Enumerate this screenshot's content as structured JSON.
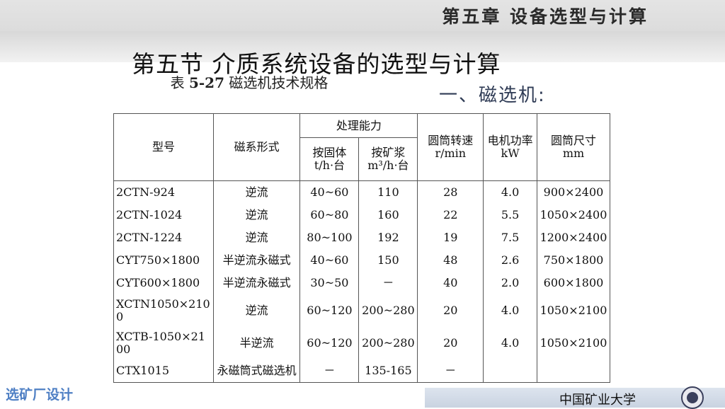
{
  "header": {
    "chapter": "第五章  设备选型与计算",
    "section": "第五节  介质系统设备的选型与计算"
  },
  "caption": {
    "label": "表",
    "number": "5-27",
    "rest": "磁选机技术规格"
  },
  "subheading": "一、磁选机:",
  "table": {
    "head": {
      "model": "型号",
      "type": "磁系形式",
      "capacity": "处理能力",
      "cap_solid": "按固体",
      "cap_solid_unit": "t/h·台",
      "cap_pulp": "按矿浆",
      "cap_pulp_unit": "m³/h·台",
      "speed": "圆筒转速",
      "speed_unit": "r/min",
      "power": "电机功率",
      "power_unit": "kW",
      "size": "圆筒尺寸",
      "size_unit": "mm"
    },
    "rows": [
      {
        "model": "2CTN-924",
        "type": "逆流",
        "solid": "40~60",
        "pulp": "110",
        "speed": "28",
        "power": "4.0",
        "size": "900×2400"
      },
      {
        "model": "2CTN-1024",
        "type": "逆流",
        "solid": "60~80",
        "pulp": "160",
        "speed": "22",
        "power": "5.5",
        "size": "1050×2400"
      },
      {
        "model": "2CTN-1224",
        "type": "逆流",
        "solid": "80~100",
        "pulp": "192",
        "speed": "19",
        "power": "7.5",
        "size": "1200×2400"
      },
      {
        "model": "CYT750×1800",
        "type": "半逆流永磁式",
        "solid": "40~60",
        "pulp": "150",
        "speed": "48",
        "power": "2.6",
        "size": "750×1800"
      },
      {
        "model": "CYT600×1800",
        "type": "半逆流永磁式",
        "solid": "30~50",
        "pulp": "－",
        "speed": "40",
        "power": "2.0",
        "size": "600×1800"
      },
      {
        "model": "XCTN1050×2100",
        "type": "逆流",
        "solid": "60~120",
        "pulp": "200~280",
        "speed": "20",
        "power": "4.0",
        "size": "1050×2100"
      },
      {
        "model": "XCTB-1050×2100",
        "type": "半逆流",
        "solid": "60~120",
        "pulp": "200~280",
        "speed": "20",
        "power": "4.0",
        "size": "1050×2100"
      },
      {
        "model": "CTX1015",
        "type": "永磁筒式磁选机",
        "solid": "－",
        "pulp": "135-165",
        "speed": "－",
        "power": "",
        "size": ""
      }
    ]
  },
  "footer": {
    "logo_text": "选矿厂设计",
    "university": "中国矿业大学",
    "emblem_icon": "university-emblem-icon"
  }
}
